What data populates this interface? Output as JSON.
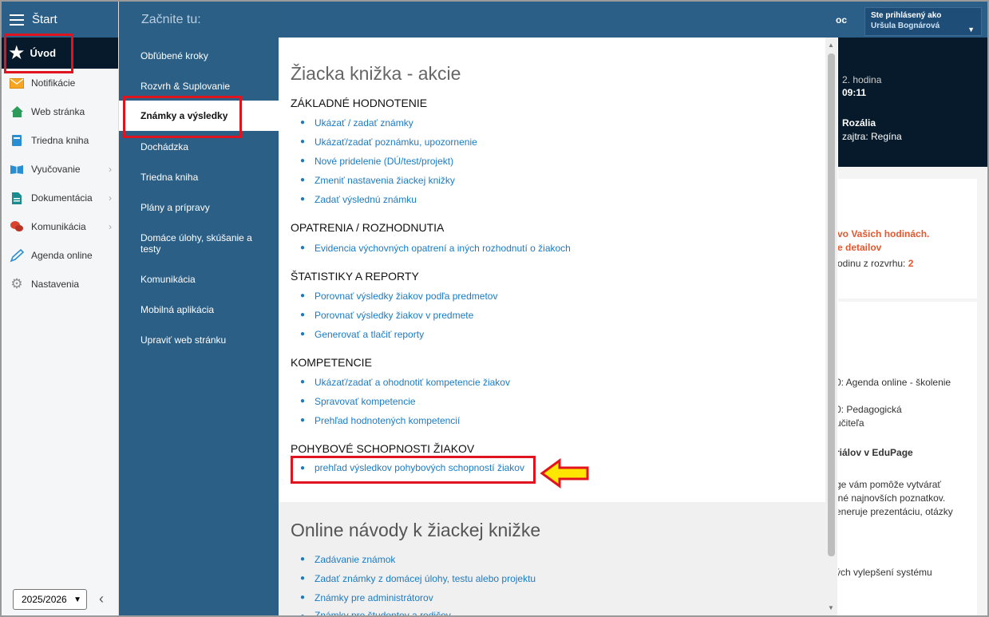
{
  "sidebar": {
    "header_label": "Štart",
    "active_item": "Úvod",
    "items": [
      {
        "label": "Notifikácie",
        "icon": "envelope-icon"
      },
      {
        "label": "Web stránka",
        "icon": "home-icon"
      },
      {
        "label": "Triedna kniha",
        "icon": "book-icon"
      },
      {
        "label": "Vyučovanie",
        "icon": "open-book-icon",
        "has_submenu": true
      },
      {
        "label": "Dokumentácia",
        "icon": "document-icon",
        "has_submenu": true
      },
      {
        "label": "Komunikácia",
        "icon": "chat-icon",
        "has_submenu": true
      },
      {
        "label": "Agenda online",
        "icon": "pen-icon"
      },
      {
        "label": "Nastavenia",
        "icon": "gear-icon"
      }
    ],
    "year": "2025/2026"
  },
  "menu": {
    "title": "Začnite tu:",
    "items": [
      "Obľúbené kroky",
      "Rozvrh & Suplovanie",
      "Známky a výsledky",
      "Dochádzka",
      "Triedna kniha",
      "Plány a prípravy",
      "Domáce úlohy, skúšanie a testy",
      "Komunikácia",
      "Mobilná aplikácia",
      "Upraviť web stránku"
    ],
    "active_index": 2
  },
  "content": {
    "heading": "Žiacka knižka - akcie",
    "sections": [
      {
        "title": "ZÁKLADNÉ HODNOTENIE",
        "links": [
          "Ukázať / zadať známky",
          "Ukázať/zadať poznámku, upozornenie",
          "Nové pridelenie (DÚ/test/projekt)",
          "Zmeniť nastavenia žiackej knižky",
          "Zadať výslednú známku"
        ]
      },
      {
        "title": "OPATRENIA / ROZHODNUTIA",
        "links": [
          "Evidencia výchovných opatrení a iných rozhodnutí o žiakoch"
        ]
      },
      {
        "title": "ŠTATISTIKY A REPORTY",
        "links": [
          "Porovnať výsledky žiakov podľa predmetov",
          "Porovnať výsledky žiakov v predmete",
          "Generovať a tlačiť reporty"
        ]
      },
      {
        "title": "KOMPETENCIE",
        "links": [
          "Ukázať/zadať a ohodnotiť kompetencie žiakov",
          "Spravovať kompetencie",
          "Prehľad hodnotených kompetencií"
        ]
      },
      {
        "title": "POHYBOVÉ SCHOPNOSTI ŽIAKOV",
        "links": [
          "prehľad výsledkov pohybových schopností žiakov"
        ]
      }
    ],
    "online_heading": "Online návody k žiackej knižke",
    "online_links": [
      "Zadávanie známok",
      "Zadať známky z domácej úlohy, testu alebo projektu",
      "Známky pre administrátorov",
      "Známky pre študentov a rodičov"
    ]
  },
  "topbar": {
    "partial_label": "oc",
    "login_label": "Ste prihlásený ako",
    "login_user": "Uršula Bognárová"
  },
  "dashboard": {
    "lesson_label": "2. hodina",
    "lesson_time": "09:11",
    "nameday": "Rozália",
    "nameday_tomorrow": "zajtra: Regína",
    "alert_line1": "vo Vašich hodinách.",
    "alert_line2": "e detailov",
    "alert_line3_prefix": "odinu z rozvrhu:",
    "alert_line3_value": "2",
    "news": [
      "0: Agenda online - školenie",
      "0: Pedagogická",
      "učiteľa",
      "riálov v EduPage",
      "ge vám pomôže vytvárať",
      "lné najnovších poznatkov.",
      "eneruje prezentáciu, otázky",
      "ých vylepšení systému"
    ]
  },
  "colors": {
    "nav_blue": "#2b5f88",
    "dark_navy": "#061a2b",
    "link_blue": "#1a7bc4",
    "highlight_red": "#e0141e",
    "arrow_yellow": "#ffe600",
    "alert_orange": "#e4572e"
  }
}
